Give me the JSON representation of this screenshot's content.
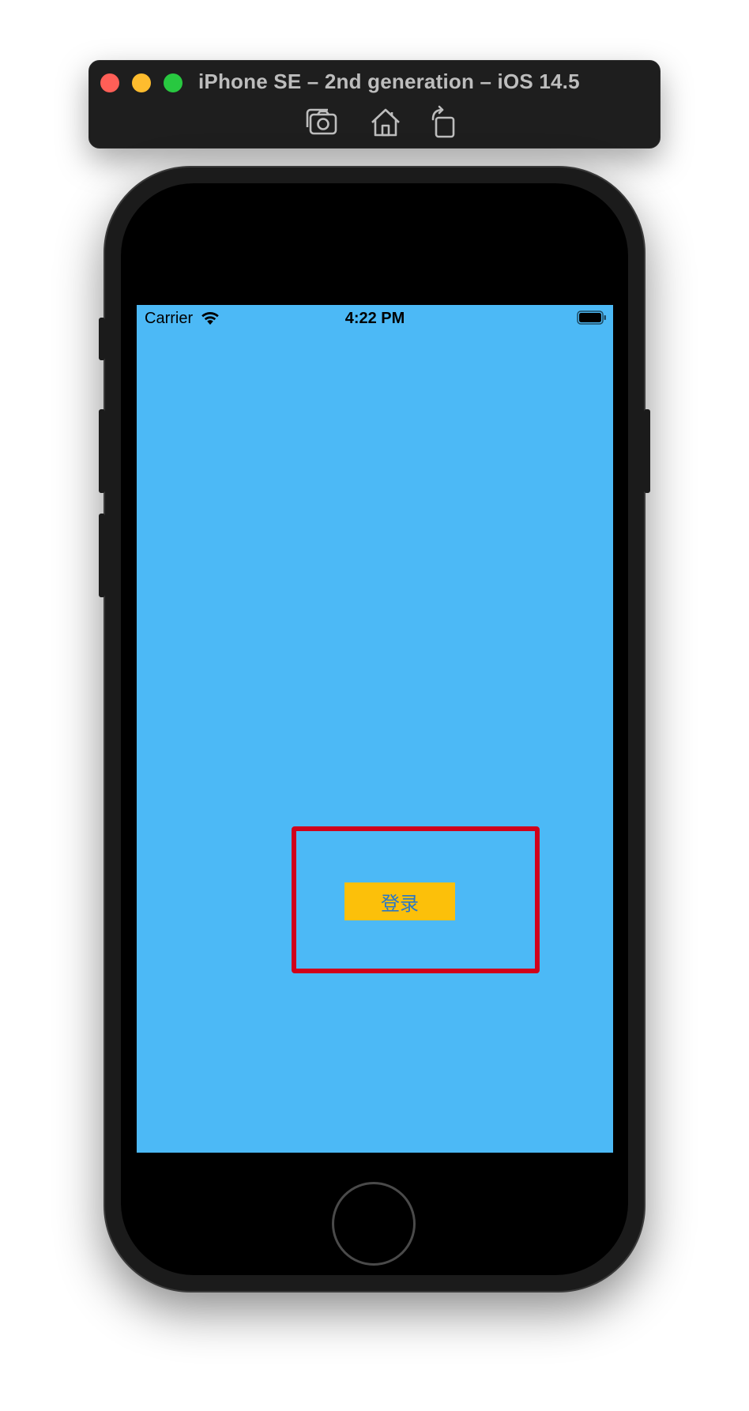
{
  "simulator": {
    "title": "iPhone SE – 2nd generation – iOS 14.5",
    "toolbar": {
      "screenshot_icon": "camera-icon",
      "home_icon": "home-icon",
      "rotate_icon": "rotate-icon"
    }
  },
  "status_bar": {
    "carrier": "Carrier",
    "time": "4:22 PM"
  },
  "screen": {
    "background_color": "#4cb9f6",
    "login_button_label": "登录",
    "login_button_color": "#fcc00a",
    "highlight_color": "#d0021b"
  }
}
